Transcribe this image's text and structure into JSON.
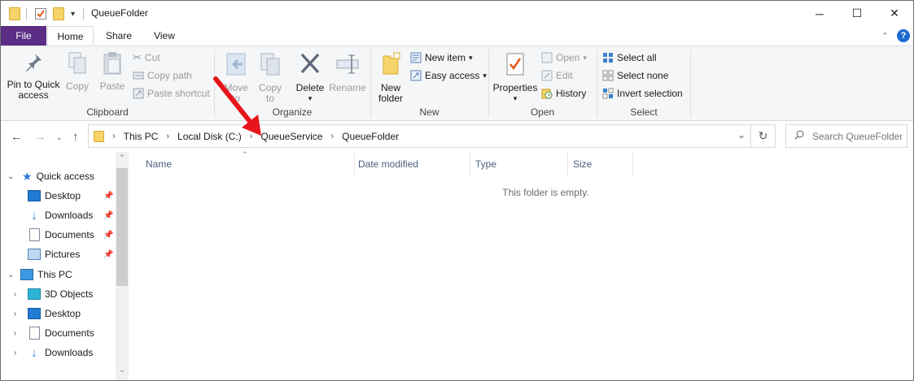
{
  "window": {
    "title": "QueueFolder",
    "minimize_glyph": "─",
    "maximize_glyph": "☐",
    "close_glyph": "✕"
  },
  "tabs": {
    "file": "File",
    "home": "Home",
    "share": "Share",
    "view": "View"
  },
  "ribbon": {
    "clipboard": {
      "label": "Clipboard",
      "pin_line1": "Pin to Quick",
      "pin_line2": "access",
      "copy": "Copy",
      "paste": "Paste",
      "cut": "Cut",
      "copy_path": "Copy path",
      "paste_shortcut": "Paste shortcut"
    },
    "organize": {
      "label": "Organize",
      "move_line1": "Move",
      "move_line2": "to",
      "copy_line1": "Copy",
      "copy_line2": "to",
      "delete": "Delete",
      "rename": "Rename"
    },
    "new": {
      "label": "New",
      "folder_line1": "New",
      "folder_line2": "folder",
      "new_item": "New item",
      "easy_access": "Easy access"
    },
    "open": {
      "label": "Open",
      "properties": "Properties",
      "open": "Open",
      "edit": "Edit",
      "history": "History"
    },
    "select": {
      "label": "Select",
      "select_all": "Select all",
      "select_none": "Select none",
      "invert_selection": "Invert selection"
    }
  },
  "address": {
    "crumbs": [
      "This PC",
      "Local Disk (C:)",
      "QueueService",
      "QueueFolder"
    ],
    "search_placeholder": "Search QueueFolder"
  },
  "nav": {
    "quick_access": "Quick access",
    "qa_items": [
      "Desktop",
      "Downloads",
      "Documents",
      "Pictures"
    ],
    "this_pc": "This PC",
    "pc_items": [
      "3D Objects",
      "Desktop",
      "Documents",
      "Downloads"
    ]
  },
  "columns": [
    "Name",
    "Date modified",
    "Type",
    "Size"
  ],
  "empty_message": "This folder is empty.",
  "colors": {
    "file_tab": "#5b2d84",
    "annotation_arrow": "#e8141b",
    "folder": "#f6d36b",
    "accent_blue": "#1b6ad1"
  }
}
